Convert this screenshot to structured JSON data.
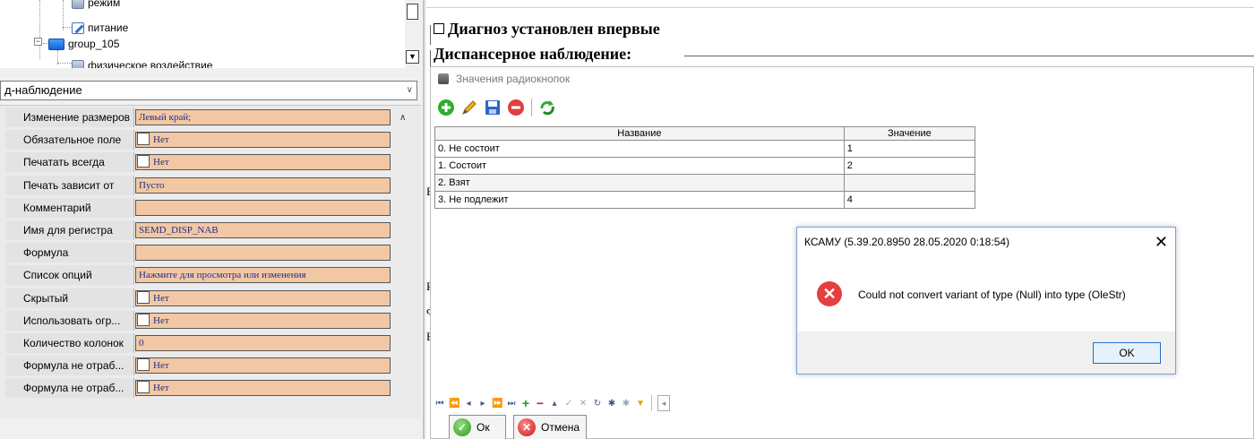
{
  "tree": {
    "items": [
      {
        "label": "режим"
      },
      {
        "label": "питание"
      },
      {
        "label": "group_105"
      },
      {
        "label": "физическое воздействие"
      }
    ]
  },
  "combo": {
    "value": "д-наблюдение"
  },
  "properties": [
    {
      "label": "Изменение размеров",
      "value": "Левый край;",
      "checkbox": false
    },
    {
      "label": "Обязательное поле",
      "value": "Нет",
      "checkbox": true
    },
    {
      "label": "Печатать всегда",
      "value": "Нет",
      "checkbox": true
    },
    {
      "label": "Печать зависит от",
      "value": "Пусто",
      "checkbox": false
    },
    {
      "label": "Комментарий",
      "value": "",
      "checkbox": false
    },
    {
      "label": "Имя для регистра",
      "value": "SEMD_DISP_NAB",
      "checkbox": false
    },
    {
      "label": "Формула",
      "value": "",
      "checkbox": false
    },
    {
      "label": "Список опций",
      "value": "Нажмите для просмотра или изменения",
      "checkbox": false
    },
    {
      "label": "Скрытый",
      "value": "Нет",
      "checkbox": true
    },
    {
      "label": "Использовать огр...",
      "value": "Нет",
      "checkbox": true
    },
    {
      "label": "Количество колонок",
      "value": "0",
      "checkbox": false
    },
    {
      "label": "Формула не отраб...",
      "value": "Нет",
      "checkbox": true
    },
    {
      "label": "Формула не отраб...",
      "value": "Нет",
      "checkbox": true
    }
  ],
  "document": {
    "diagnosis_label": "Диагноз установлен впервые",
    "dispensary_label": "Диспансерное наблюдение:",
    "fragments": [
      "Б",
      "Р",
      "Ф",
      "Е"
    ]
  },
  "radio_window": {
    "title": "Значения радиокнопок",
    "columns": [
      "Название",
      "Значение"
    ],
    "rows": [
      {
        "name": "0. Не состоит",
        "value": "1"
      },
      {
        "name": "1. Состоит",
        "value": "2"
      },
      {
        "name": "2. Взят",
        "value": ""
      },
      {
        "name": "3. Не подлежит",
        "value": "4"
      }
    ],
    "ok_label": "Ок",
    "cancel_label": "Отмена"
  },
  "error_dialog": {
    "title": "КСАМУ (5.39.20.8950 28.05.2020 0:18:54)",
    "message": "Could not convert variant of type (Null) into type (OleStr)",
    "ok_label": "OK",
    "close_glyph": "✕"
  },
  "icons": {
    "add": "plus-circle-icon",
    "edit": "pencil-icon",
    "save": "floppy-disk-icon",
    "delete": "minus-circle-icon",
    "refresh": "refresh-icon",
    "error": "error-x-icon"
  },
  "colors": {
    "property_value_bg": "#f2c8a4",
    "property_value_text": "#1e2e8c",
    "error_red": "#e53f3f",
    "ok_green": "#2e9a20",
    "cancel_red": "#c81818"
  }
}
